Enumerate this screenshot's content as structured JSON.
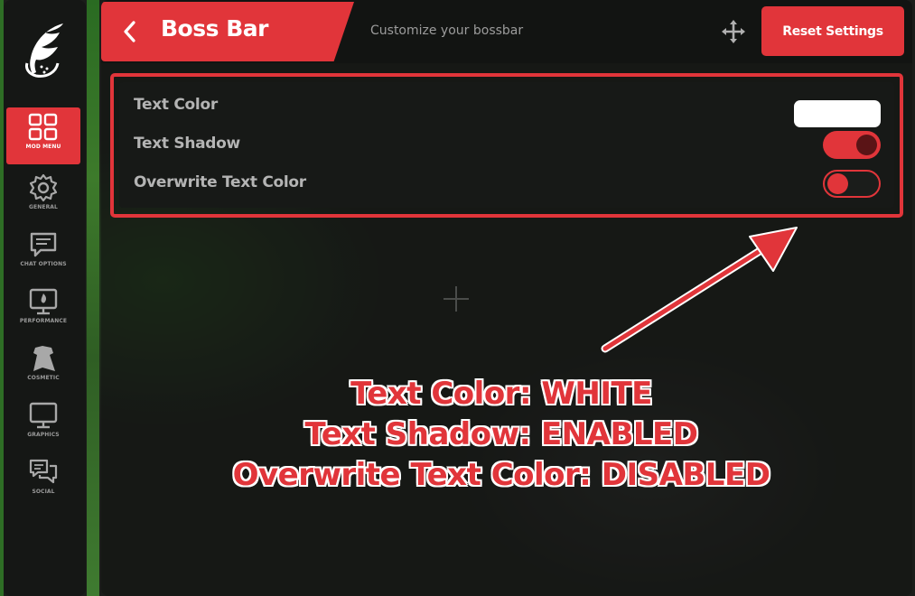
{
  "sidebar": {
    "items": [
      {
        "label": "MOD MENU",
        "icon": "grid-icon",
        "active": true
      },
      {
        "label": "GENERAL",
        "icon": "gear-icon",
        "active": false
      },
      {
        "label": "CHAT OPTIONS",
        "icon": "chat-icon",
        "active": false
      },
      {
        "label": "PERFORMANCE",
        "icon": "monitor-flame-icon",
        "active": false
      },
      {
        "label": "COSMETIC",
        "icon": "cape-icon",
        "active": false
      },
      {
        "label": "GRAPHICS",
        "icon": "monitor-icon",
        "active": false
      },
      {
        "label": "SOCIAL",
        "icon": "chat-bubbles-icon",
        "active": false
      }
    ]
  },
  "header": {
    "title": "Boss Bar",
    "subtitle": "Customize your bossbar",
    "reset_label": "Reset Settings"
  },
  "settings": [
    {
      "label": "Text Color",
      "control": "color",
      "value": "#ffffff"
    },
    {
      "label": "Text Shadow",
      "control": "toggle",
      "value": true
    },
    {
      "label": "Overwrite Text Color",
      "control": "toggle",
      "value": false
    }
  ],
  "annotation": {
    "lines": [
      "Text Color: WHITE",
      "Text Shadow: ENABLED",
      "Overwrite Text Color: DISABLED"
    ]
  },
  "colors": {
    "accent": "#e1353a",
    "sidebar_bg": "#151715",
    "panel_bg": "#121412",
    "text_muted": "#b4b4b4"
  }
}
